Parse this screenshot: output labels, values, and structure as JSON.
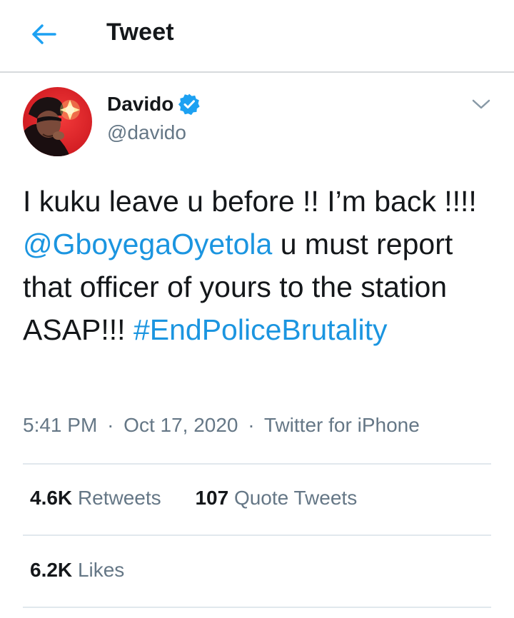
{
  "header": {
    "title": "Tweet",
    "back_icon": "arrow-left-icon",
    "accent_color": "#1da1f2"
  },
  "author": {
    "name": "Davido",
    "handle": "@davido",
    "verified": true,
    "verified_icon": "verified-badge-icon",
    "avatar": "avatar"
  },
  "tweet": {
    "text_part1": "I kuku leave u before !! I’m back !!!! ",
    "mention": "@GboyegaOyetola",
    "text_part2": " u must report that officer of yours to the station ASAP!!! ",
    "hashtag": "#EndPoliceBrutality",
    "link_color": "#1b95e0"
  },
  "meta": {
    "time": "5:41 PM",
    "separator": "·",
    "date": "Oct 17, 2020",
    "source": "Twitter for iPhone"
  },
  "stats": {
    "retweets_count": "4.6K",
    "retweets_label": "Retweets",
    "quotes_count": "107",
    "quotes_label": "Quote Tweets",
    "likes_count": "6.2K",
    "likes_label": "Likes"
  }
}
